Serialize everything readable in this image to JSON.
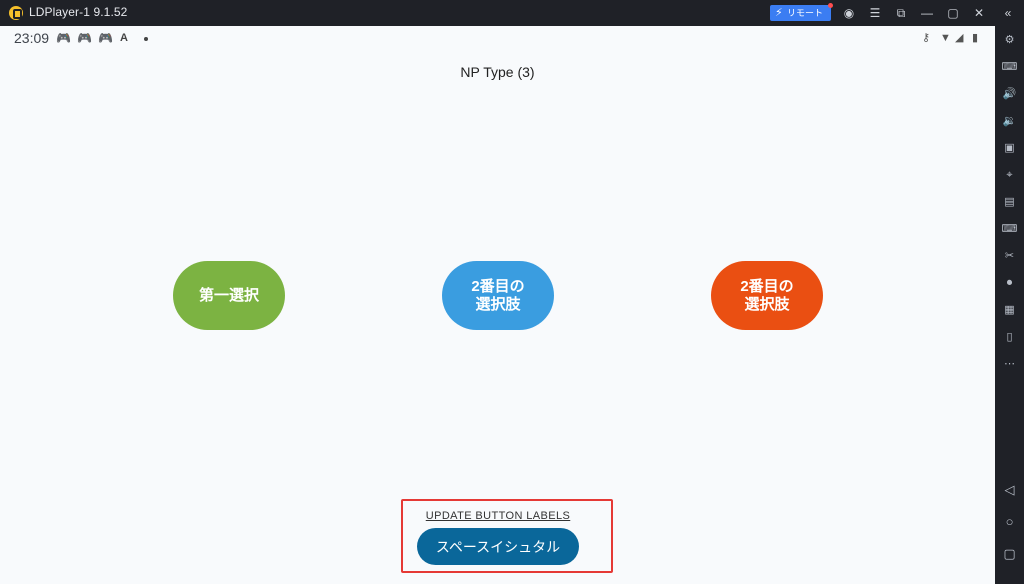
{
  "window": {
    "title": "LDPlayer-1 9.1.52",
    "remote_label": "リモート",
    "icons": [
      "account-icon",
      "menu-icon",
      "popout-icon",
      "minimize-icon",
      "maximize-icon",
      "close-icon",
      "collapse-icon"
    ]
  },
  "status_bar": {
    "time": "23:09",
    "left_icons": [
      "gamepad-icon",
      "gamepad-icon",
      "gamepad-icon",
      "app-a-icon"
    ],
    "right_icons": [
      "key-icon",
      "wifi-icon",
      "signal-icon",
      "battery-icon"
    ]
  },
  "screen": {
    "title": "NP Type (3)",
    "buttons": [
      {
        "label": "第一選択",
        "color": "#7cb342"
      },
      {
        "label": "2番目の\n選択肢",
        "color": "#3a9de0"
      },
      {
        "label": "2番目の\n選択肢",
        "color": "#ea4f12"
      }
    ],
    "update_link": "UPDATE BUTTON LABELS",
    "primary_button": "スペースイシュタル",
    "highlight_color": "#e53935"
  },
  "sidebar": {
    "icons": [
      "settings-icon",
      "keyboard-mapping-icon",
      "volume-up-icon",
      "volume-down-icon",
      "screenshot-icon",
      "location-icon",
      "apk-install-icon",
      "keyboard-icon",
      "scissors-icon",
      "record-icon",
      "operation-record-icon",
      "rotate-icon",
      "more-icon"
    ],
    "nav": [
      "back-icon",
      "home-icon",
      "recent-apps-icon"
    ]
  }
}
